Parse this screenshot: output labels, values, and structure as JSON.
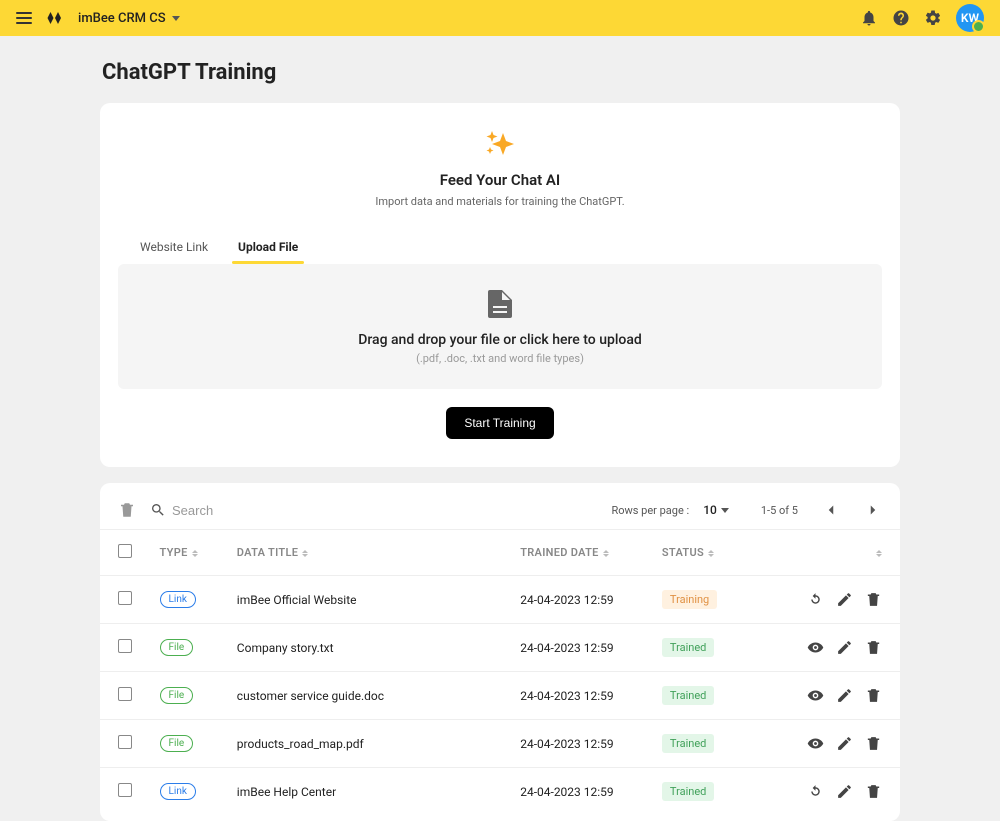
{
  "header": {
    "app_name": "imBee CRM CS",
    "avatar_initials": "KW"
  },
  "page": {
    "title": "ChatGPT Training"
  },
  "feed": {
    "title": "Feed Your Chat AI",
    "desc": "Import data and materials for training the ChatGPT."
  },
  "tabs": {
    "website": "Website Link",
    "upload": "Upload File"
  },
  "dropzone": {
    "text": "Drag and drop your file or click here to upload",
    "hint": "(.pdf, .doc, .txt and word file types)"
  },
  "buttons": {
    "start_training": "Start Training"
  },
  "search": {
    "placeholder": "Search"
  },
  "pagination": {
    "rpp_label": "Rows per page :",
    "rpp_value": "10",
    "range": "1-5 of 5"
  },
  "columns": {
    "type": "TYPE",
    "title": "DATA TITLE",
    "date": "TRAINED DATE",
    "status": "STATUS"
  },
  "badges": {
    "link": "Link",
    "file": "File"
  },
  "statuses": {
    "training": "Training",
    "trained": "Trained"
  },
  "rows": [
    {
      "type": "link",
      "title": "imBee Official Website",
      "date": "24-04-2023 12:59",
      "status": "training",
      "action": "refresh"
    },
    {
      "type": "file",
      "title": "Company story.txt",
      "date": "24-04-2023 12:59",
      "status": "trained",
      "action": "view"
    },
    {
      "type": "file",
      "title": "customer service guide.doc",
      "date": "24-04-2023 12:59",
      "status": "trained",
      "action": "view"
    },
    {
      "type": "file",
      "title": "products_road_map.pdf",
      "date": "24-04-2023 12:59",
      "status": "trained",
      "action": "view"
    },
    {
      "type": "link",
      "title": "imBee Help Center",
      "date": "24-04-2023 12:59",
      "status": "trained",
      "action": "refresh"
    }
  ]
}
